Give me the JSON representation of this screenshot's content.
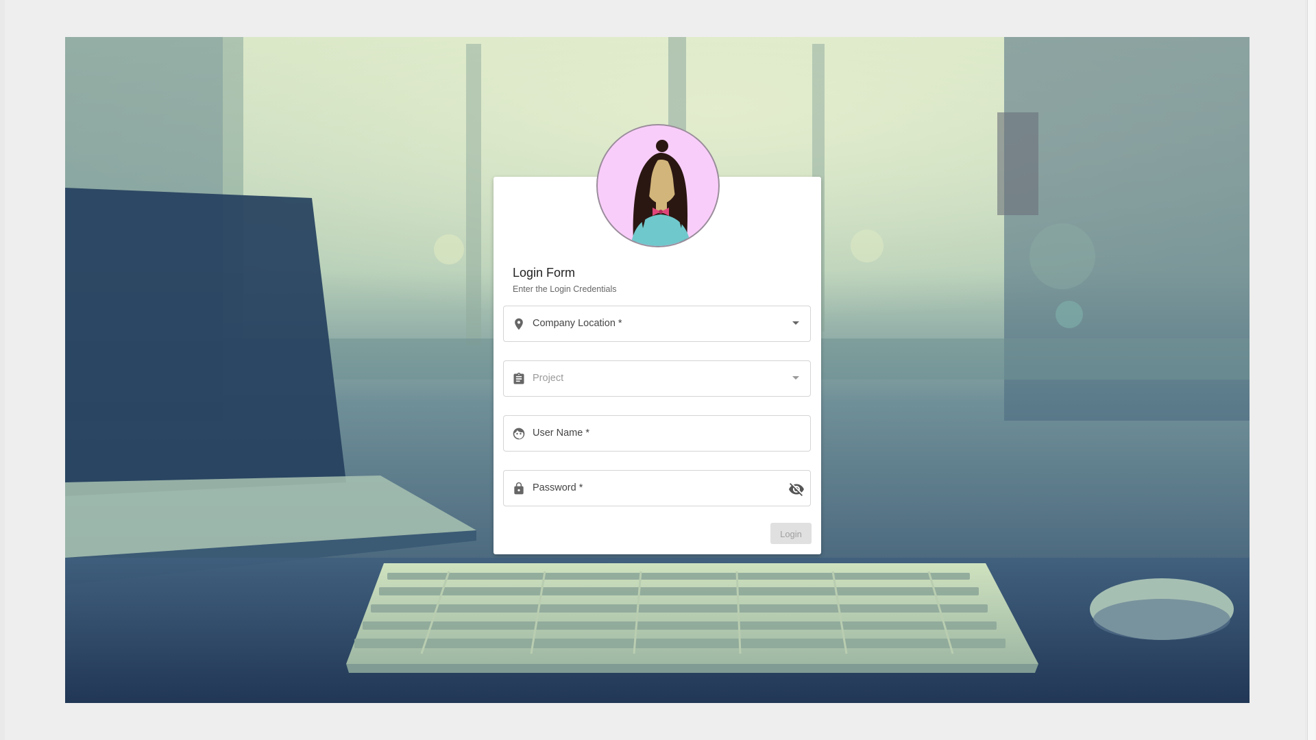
{
  "form": {
    "title": "Login Form",
    "subtitle": "Enter the Login Credentials",
    "fields": [
      {
        "label": "Company Location *",
        "icon": "location-pin-icon",
        "type": "select",
        "enabled": true
      },
      {
        "label": "Project",
        "icon": "clipboard-icon",
        "type": "select",
        "enabled": false
      },
      {
        "label": "User Name *",
        "icon": "user-face-icon",
        "type": "text",
        "enabled": true
      },
      {
        "label": "Password *",
        "icon": "lock-icon",
        "type": "password",
        "enabled": true,
        "trailing_icon": "visibility-off-icon"
      }
    ],
    "login_label": "Login"
  },
  "colors": {
    "avatar_bg": "#f9cdfa",
    "button_disabled_bg": "#e0e0e0",
    "button_disabled_text": "#a0a0a0"
  }
}
